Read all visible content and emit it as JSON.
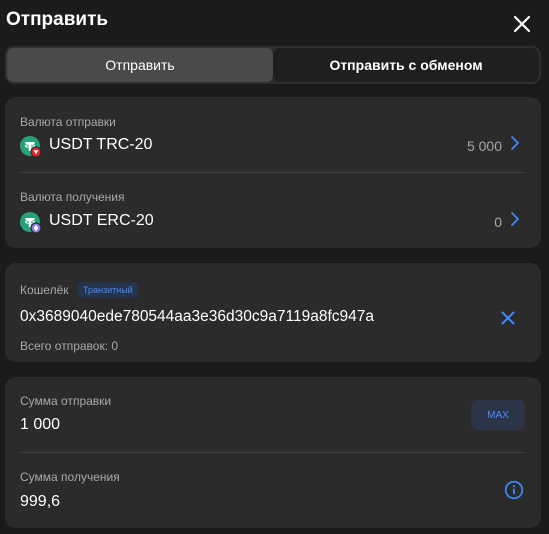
{
  "header": {
    "title": "Отправить"
  },
  "tabs": [
    {
      "label": "Отправить"
    },
    {
      "label": "Отправить с обменом"
    }
  ],
  "currency": {
    "send_label": "Валюта отправки",
    "send_coin": "USDT TRC-20",
    "send_balance": "5 000",
    "receive_label": "Валюта получения",
    "receive_coin": "USDT ERC-20",
    "receive_balance": "0"
  },
  "wallet": {
    "label": "Кошелёк",
    "badge": "Транзитный",
    "address": "0x3689040ede780544aa3e36d30c9a7119a8fc947a",
    "sent_count": "Всего отправок: 0"
  },
  "amounts": {
    "send_label": "Сумма отправки",
    "send_value": "1 000",
    "max_label": "MAX",
    "receive_label": "Сумма получения",
    "receive_value": "999,6"
  },
  "colors": {
    "accent": "#3d8bff",
    "tether": "#26a17b",
    "trc_badge": "#e0262b",
    "erc_badge": "#8e7cf0"
  },
  "icons": [
    "close-icon",
    "chevron-right-icon",
    "usdt-trc20-icon",
    "usdt-erc20-icon",
    "clear-icon",
    "info-icon"
  ]
}
